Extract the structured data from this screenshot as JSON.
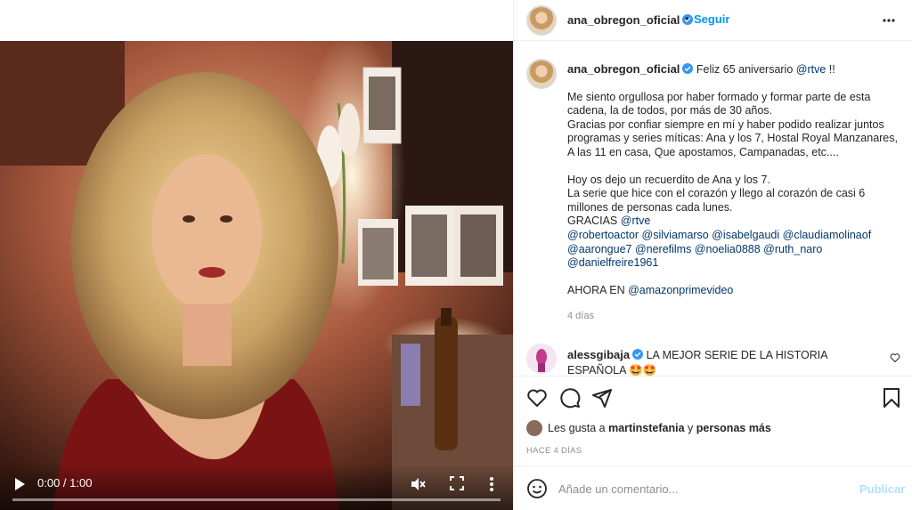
{
  "video": {
    "time": "0:00 / 1:00",
    "progress": 0
  },
  "post": {
    "username": "ana_obregon_oficial",
    "follow_label": "Seguir",
    "separator": "•",
    "caption": {
      "first_line": "Feliz 65 aniversario ",
      "first_mention": "@rtve",
      "first_tail": " !!",
      "paragraph1": "Me siento orgullosa por haber formado y formar parte de esta cadena, la de todos, por más de 30 años.",
      "paragraph2": "Gracias por confiar siempre en mí y haber podido realizar juntos programas y series míticas: Ana y los 7, Hostal Royal Manzanares, A las 11 en casa, Que apostamos, Campanadas, etc....",
      "paragraph3a": "Hoy os dejo un recuerdito de Ana y los 7.",
      "paragraph3b": "La serie que hice con el corazón y llego al corazón de casi 6 millones de personas cada lunes.",
      "gracias": "GRACIAS ",
      "gracias_mention": "@rtve",
      "mentions": "@robertoactor @silviamarso @isabelgaudi @claudiamolinaof @aarongue7 @nerefilms @noelia0888 @ruth_naro @danielfreire1961",
      "ahora_prefix": "AHORA EN ",
      "ahora_mention": "@amazonprimevideo",
      "time": "4 días"
    },
    "comment": {
      "username": "alessgibaja",
      "text": "LA MEJOR SERIE DE LA HISTORIA ESPAÑOLA 🤩🤩"
    },
    "likes": {
      "prefix": "Les gusta a ",
      "user": "martinstefania",
      "middle": " y ",
      "others": "personas más"
    },
    "date": "HACE 4 DÍAS",
    "add_comment": {
      "placeholder": "Añade un comentario...",
      "publish_label": "Publicar"
    }
  },
  "colors": {
    "accent": "#0095f6",
    "mention": "#00376b",
    "muted": "#8e8e8e",
    "publish_disabled": "#b2dffc"
  }
}
